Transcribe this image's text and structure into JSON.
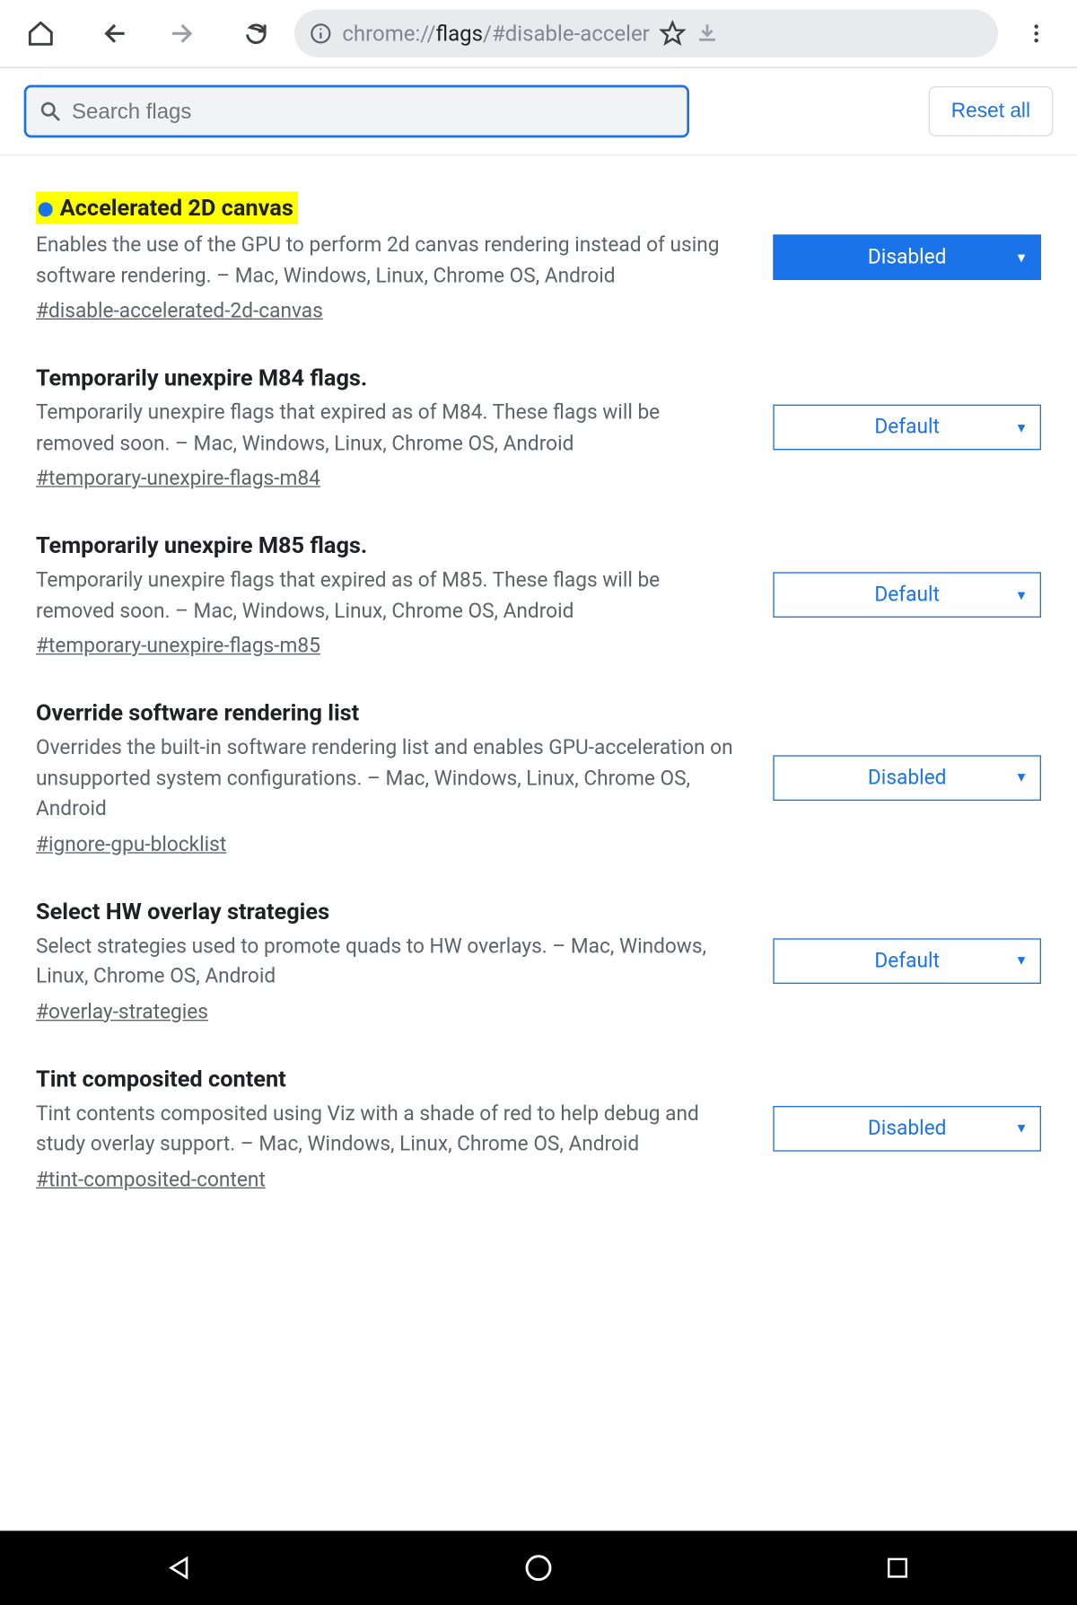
{
  "url": {
    "prefix": "chrome://",
    "host": "flags",
    "path": "/#disable-acceler"
  },
  "search": {
    "placeholder": "Search flags"
  },
  "reset_label": "Reset all",
  "flags": [
    {
      "title": "Accelerated 2D canvas",
      "highlighted": true,
      "desc": "Enables the use of the GPU to perform 2d canvas rendering instead of using software rendering. – Mac, Windows, Linux, Chrome OS, Android",
      "hash": "#disable-accelerated-2d-canvas",
      "value": "Disabled",
      "solid": true
    },
    {
      "title": "Temporarily unexpire M84 flags.",
      "desc": "Temporarily unexpire flags that expired as of M84. These flags will be removed soon. – Mac, Windows, Linux, Chrome OS, Android",
      "hash": "#temporary-unexpire-flags-m84",
      "value": "Default"
    },
    {
      "title": "Temporarily unexpire M85 flags.",
      "desc": "Temporarily unexpire flags that expired as of M85. These flags will be removed soon. – Mac, Windows, Linux, Chrome OS, Android",
      "hash": "#temporary-unexpire-flags-m85",
      "value": "Default"
    },
    {
      "title": "Override software rendering list",
      "desc": "Overrides the built-in software rendering list and enables GPU-acceleration on unsupported system configurations. – Mac, Windows, Linux, Chrome OS, Android",
      "hash": "#ignore-gpu-blocklist",
      "value": "Disabled"
    },
    {
      "title": "Select HW overlay strategies",
      "desc": "Select strategies used to promote quads to HW overlays. – Mac, Windows, Linux, Chrome OS, Android",
      "hash": "#overlay-strategies",
      "value": "Default"
    },
    {
      "title": "Tint composited content",
      "desc": "Tint contents composited using Viz with a shade of red to help debug and study overlay support. – Mac, Windows, Linux, Chrome OS, Android",
      "hash": "#tint-composited-content",
      "value": "Disabled"
    }
  ]
}
